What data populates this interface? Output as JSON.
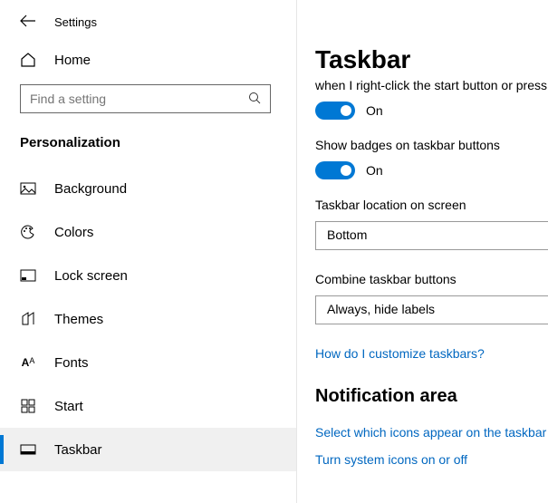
{
  "header": {
    "title": "Settings"
  },
  "home": {
    "label": "Home"
  },
  "search": {
    "placeholder": "Find a setting"
  },
  "section": "Personalization",
  "nav": [
    {
      "label": "Background"
    },
    {
      "label": "Colors"
    },
    {
      "label": "Lock screen"
    },
    {
      "label": "Themes"
    },
    {
      "label": "Fonts"
    },
    {
      "label": "Start"
    },
    {
      "label": "Taskbar"
    }
  ],
  "main": {
    "title": "Taskbar",
    "desc1": "when I right-click the start button or press",
    "toggle1_state": "On",
    "label2": "Show badges on taskbar buttons",
    "toggle2_state": "On",
    "loc_label": "Taskbar location on screen",
    "loc_value": "Bottom",
    "combine_label": "Combine taskbar buttons",
    "combine_value": "Always, hide labels",
    "help_link": "How do I customize taskbars?",
    "notif_title": "Notification area",
    "notif_link1": "Select which icons appear on the taskbar",
    "notif_link2": "Turn system icons on or off"
  }
}
